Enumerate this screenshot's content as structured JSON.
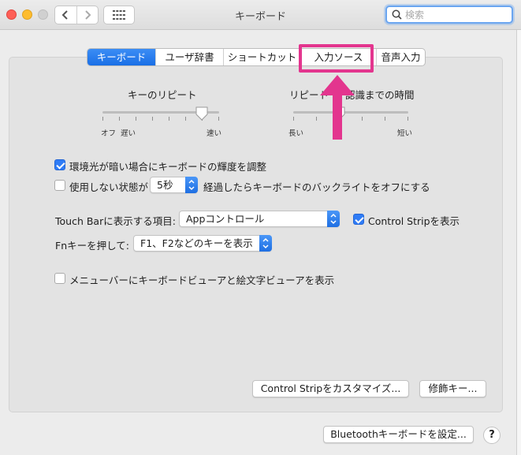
{
  "window": {
    "title": "キーボード"
  },
  "search": {
    "placeholder": "検索"
  },
  "tabs": [
    {
      "label": "キーボード",
      "active": true
    },
    {
      "label": "ユーザ辞書",
      "active": false
    },
    {
      "label": "ショートカット",
      "active": false
    },
    {
      "label": "入力ソース",
      "active": false
    },
    {
      "label": "音声入力",
      "active": false
    }
  ],
  "key_repeat": {
    "title": "キーのリピート",
    "left_label": "オフ",
    "left_label2": "遅い",
    "right_label": "速い",
    "level": 0.85
  },
  "repeat_delay": {
    "title_left": "リピート",
    "title_right": "認識までの時間",
    "left_label": "長い",
    "right_label": "短い",
    "level": 0.4
  },
  "options": {
    "brightness_label": "環境光が暗い場合にキーボードの輝度を調整",
    "brightness_checked": true,
    "idle_prefix": "使用しない状態が",
    "idle_value": "5秒",
    "idle_suffix": "経過したらキーボードのバックライトをオフにする",
    "idle_checked": false
  },
  "touchbar": {
    "label": "Touch Barに表示する項目:",
    "value": "Appコントロール",
    "control_strip_label": "Control Stripを表示",
    "control_strip_checked": true
  },
  "fn": {
    "label": "Fnキーを押して:",
    "value": "F1、F2などのキーを表示"
  },
  "viewer": {
    "label": "メニューバーにキーボードビューアと絵文字ビューアを表示",
    "checked": false
  },
  "buttons": {
    "customize": "Control Stripをカスタマイズ...",
    "modifier": "修飾キー...",
    "bluetooth": "Bluetoothキーボードを設定...",
    "help": "?"
  },
  "colors": {
    "accent": "#1a6fe6",
    "highlight": "#e3358e"
  }
}
